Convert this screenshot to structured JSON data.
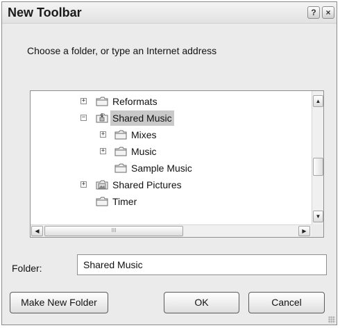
{
  "window": {
    "title": "New Toolbar",
    "help_glyph": "?",
    "close_glyph": "×"
  },
  "prompt": "Choose a folder, or type an Internet address",
  "tree": {
    "items": [
      {
        "label": "Reformats",
        "expander": "+",
        "icon": "folder-icon"
      },
      {
        "label": "Shared Music",
        "expander": "−",
        "icon": "shared-music-folder-icon",
        "selected": true
      },
      {
        "label": "Mixes",
        "expander": "+",
        "icon": "folder-icon"
      },
      {
        "label": "Music",
        "expander": "+",
        "icon": "folder-icon"
      },
      {
        "label": "Sample Music",
        "expander": "",
        "icon": "folder-icon"
      },
      {
        "label": "Shared Pictures",
        "expander": "+",
        "icon": "shared-pictures-folder-icon"
      },
      {
        "label": "Timer",
        "expander": "",
        "icon": "folder-icon"
      }
    ],
    "scroll_up_glyph": "▲",
    "scroll_down_glyph": "▼",
    "scroll_left_glyph": "◀",
    "scroll_right_glyph": "▶",
    "hthumb_grip": "III"
  },
  "folder_field": {
    "label": "Folder:",
    "value": "Shared Music"
  },
  "buttons": {
    "make_new_folder": "Make New Folder",
    "ok": "OK",
    "cancel": "Cancel"
  }
}
